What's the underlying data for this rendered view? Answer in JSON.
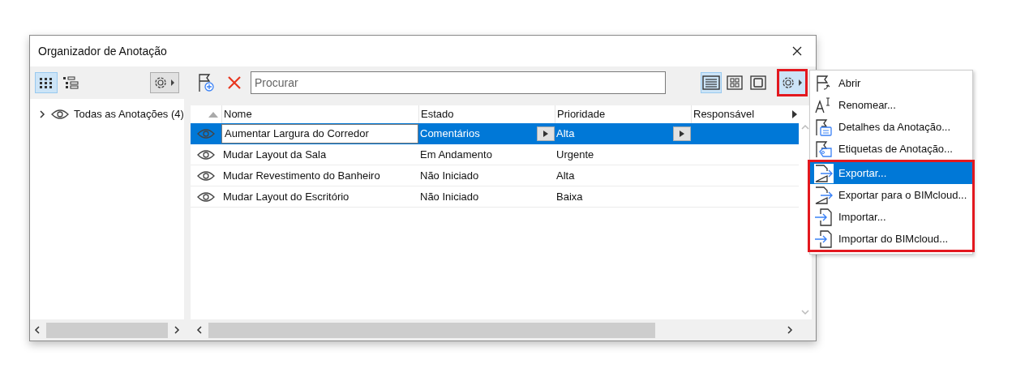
{
  "window": {
    "title": "Organizador de Anotação"
  },
  "left_toolbar": {
    "views": [
      {
        "kind": "grid",
        "selected": true
      },
      {
        "kind": "tree",
        "selected": false
      }
    ]
  },
  "tree": [
    {
      "label": "Todas as Anotações (4)",
      "expanded": false
    }
  ],
  "search": {
    "placeholder": "Procurar"
  },
  "view_buttons": [
    {
      "kind": "list",
      "selected": true
    },
    {
      "kind": "tiles",
      "selected": false
    },
    {
      "kind": "single",
      "selected": false
    }
  ],
  "settings_button": {
    "framed": true,
    "selected": true
  },
  "table": {
    "columns": [
      "Nome",
      "Estado",
      "Prioridade",
      "Responsável"
    ],
    "rows": [
      {
        "name": "Aumentar Largura do Corredor",
        "state": "Comentários",
        "priority": "Alta",
        "selected": true
      },
      {
        "name": "Mudar Layout da Sala",
        "state": "Em Andamento",
        "priority": "Urgente",
        "selected": false
      },
      {
        "name": "Mudar Revestimento do Banheiro",
        "state": "Não Iniciado",
        "priority": "Alta",
        "selected": false
      },
      {
        "name": "Mudar Layout do Escritório",
        "state": "Não Iniciado",
        "priority": "Baixa",
        "selected": false
      }
    ]
  },
  "menu": {
    "sections": [
      {
        "framed": false,
        "items": [
          {
            "label": "Abrir",
            "kind": "open",
            "selected": false
          },
          {
            "label": "Renomear...",
            "kind": "rename",
            "selected": false
          },
          {
            "label": "Detalhes da Anotação...",
            "kind": "details",
            "selected": false
          },
          {
            "label": "Etiquetas de Anotação...",
            "kind": "tags",
            "selected": false
          }
        ]
      },
      {
        "framed": true,
        "items": [
          {
            "label": "Exportar...",
            "kind": "export",
            "selected": true
          },
          {
            "label": "Exportar para o BIMcloud...",
            "kind": "export",
            "selected": false
          },
          {
            "label": "Importar...",
            "kind": "import",
            "selected": false
          },
          {
            "label": "Importar do BIMcloud...",
            "kind": "import",
            "selected": false
          }
        ]
      }
    ]
  }
}
